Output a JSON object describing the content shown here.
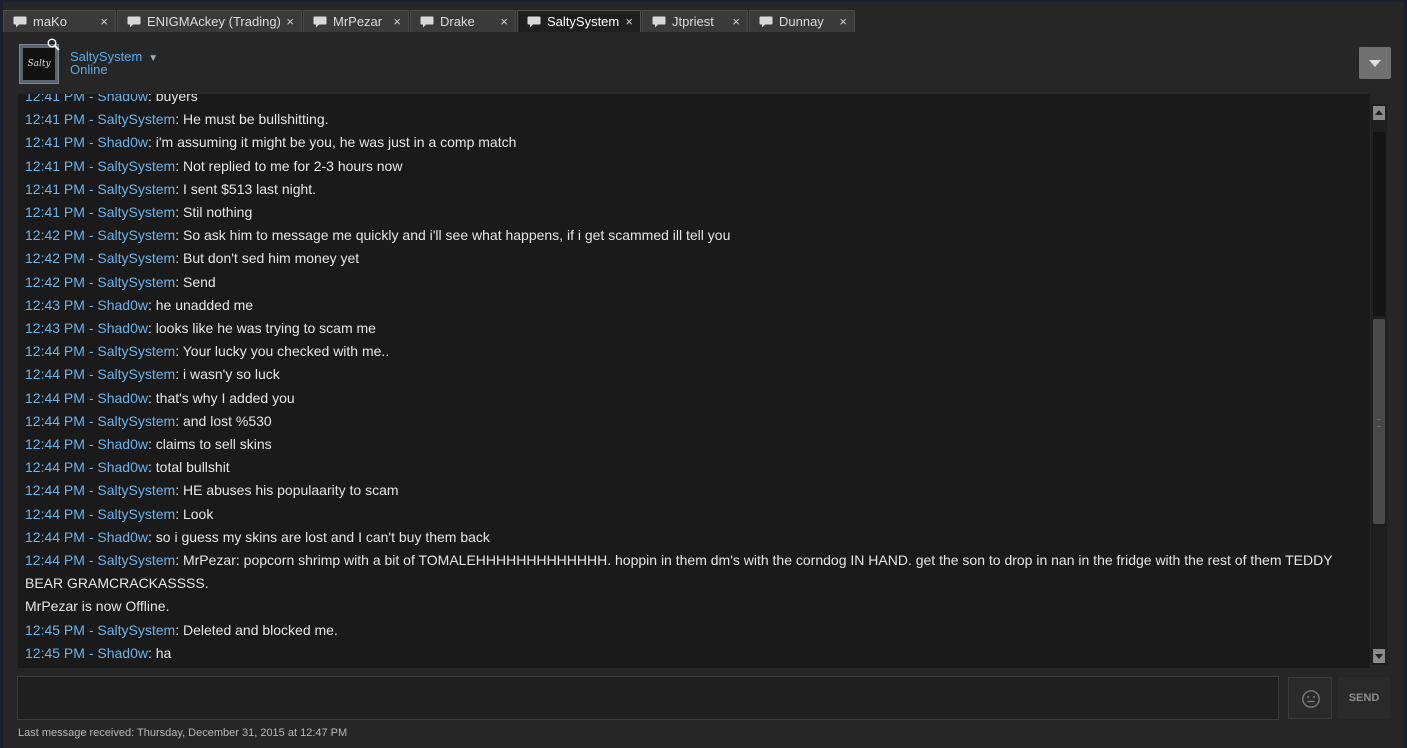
{
  "tabs": [
    {
      "label": "maKo",
      "active": false
    },
    {
      "label": "ENIGMAckey (Trading)",
      "active": false
    },
    {
      "label": "MrPezar",
      "active": false
    },
    {
      "label": "Drake",
      "active": false
    },
    {
      "label": "SaltySystem",
      "active": true
    },
    {
      "label": "Jtpriest",
      "active": false
    },
    {
      "label": "Dunnay",
      "active": false
    }
  ],
  "tab_close_glyph": "×",
  "contact": {
    "name": "SaltySystem",
    "status": "Online",
    "avatar_text": "Salty"
  },
  "messages": [
    {
      "time": "12:41 PM",
      "sender": "Shad0w",
      "text": "buyers"
    },
    {
      "time": "12:41 PM",
      "sender": "SaltySystem",
      "text": "He must be bullshitting."
    },
    {
      "time": "12:41 PM",
      "sender": "Shad0w",
      "text": "i'm assuming it might be you, he was just in a comp match"
    },
    {
      "time": "12:41 PM",
      "sender": "SaltySystem",
      "text": "Not replied to me for 2-3 hours now"
    },
    {
      "time": "12:41 PM",
      "sender": "SaltySystem",
      "text": "I sent $513 last night."
    },
    {
      "time": "12:41 PM",
      "sender": "SaltySystem",
      "text": "Stil nothing"
    },
    {
      "time": "12:42 PM",
      "sender": "SaltySystem",
      "text": "So ask him to message me quickly and i'll see what happens, if i get scammed ill tell you"
    },
    {
      "time": "12:42 PM",
      "sender": "SaltySystem",
      "text": "But don't sed him money yet"
    },
    {
      "time": "12:42 PM",
      "sender": "SaltySystem",
      "text": "Send"
    },
    {
      "time": "12:43 PM",
      "sender": "Shad0w",
      "text": "he unadded me"
    },
    {
      "time": "12:43 PM",
      "sender": "Shad0w",
      "text": "looks like he was trying to scam me"
    },
    {
      "time": "12:44 PM",
      "sender": "SaltySystem",
      "text": "Your lucky you checked with me.."
    },
    {
      "time": "12:44 PM",
      "sender": "SaltySystem",
      "text": "i wasn'y so luck"
    },
    {
      "time": "12:44 PM",
      "sender": "Shad0w",
      "text": "that's why I added you"
    },
    {
      "time": "12:44 PM",
      "sender": "SaltySystem",
      "text": "and lost %530"
    },
    {
      "time": "12:44 PM",
      "sender": "Shad0w",
      "text": "claims to sell skins"
    },
    {
      "time": "12:44 PM",
      "sender": "Shad0w",
      "text": "total bullshit"
    },
    {
      "time": "12:44 PM",
      "sender": "SaltySystem",
      "text": "HE abuses his populaarity to scam"
    },
    {
      "time": "12:44 PM",
      "sender": "SaltySystem",
      "text": "Look"
    },
    {
      "time": "12:44 PM",
      "sender": "Shad0w",
      "text": "so i guess my skins are lost and I can't buy them back"
    },
    {
      "time": "12:44 PM",
      "sender": "SaltySystem",
      "text": "MrPezar: popcorn shrimp with a bit of TOMALEHHHHHHHHHHHHH. hoppin in them dm's with the corndog IN HAND. get the son to drop in nan in the fridge with the rest of them TEDDY BEAR GRAMCRACKASSSS."
    },
    {
      "system": "MrPezar is now Offline."
    },
    {
      "time": "12:45 PM",
      "sender": "SaltySystem",
      "text": "Deleted and blocked me."
    },
    {
      "time": "12:45 PM",
      "sender": "Shad0w",
      "text": "ha"
    }
  ],
  "composer": {
    "value": "",
    "send_label": "SEND"
  },
  "footer": {
    "last_message": "Last message received: Thursday, December 31, 2015 at 12:47 PM"
  },
  "icons": {
    "tab": "chat-bubble-icon",
    "emoji": "smiley-icon",
    "dropdown": "chevron-down-icon",
    "zoom": "magnifier-icon"
  },
  "colors": {
    "name_link": "#6eb3e8",
    "message_text": "#e6e6e6",
    "log_background": "#1a1a1a",
    "window_background": "#262626"
  }
}
